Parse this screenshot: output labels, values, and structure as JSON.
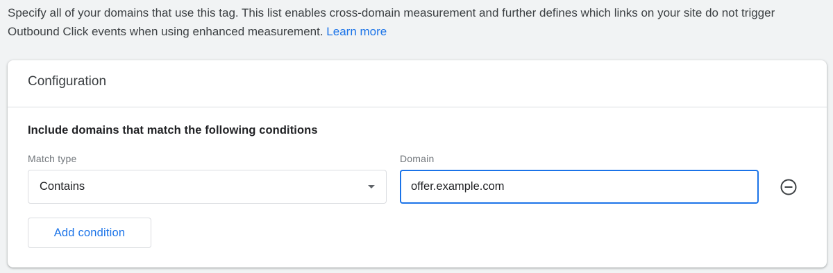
{
  "intro": {
    "text": "Specify all of your domains that use this tag. This list enables cross-domain measurement and further defines which links on your site do not trigger Outbound Click events when using enhanced measurement.",
    "link_label": "Learn more"
  },
  "card": {
    "title": "Configuration",
    "section_heading": "Include domains that match the following conditions",
    "match_type": {
      "label": "Match type",
      "value": "Contains",
      "icon": "dropdown-caret-icon"
    },
    "domain": {
      "label": "Domain",
      "value": "offer.example.com",
      "placeholder": ""
    },
    "remove_icon": "remove-circle-icon",
    "add_condition_label": "Add condition"
  },
  "colors": {
    "accent": "#1a73e8",
    "page_background": "#f1f3f4",
    "card_background": "#ffffff",
    "border": "#dadce0",
    "text": "#3c4043",
    "muted_text": "#70757a"
  }
}
